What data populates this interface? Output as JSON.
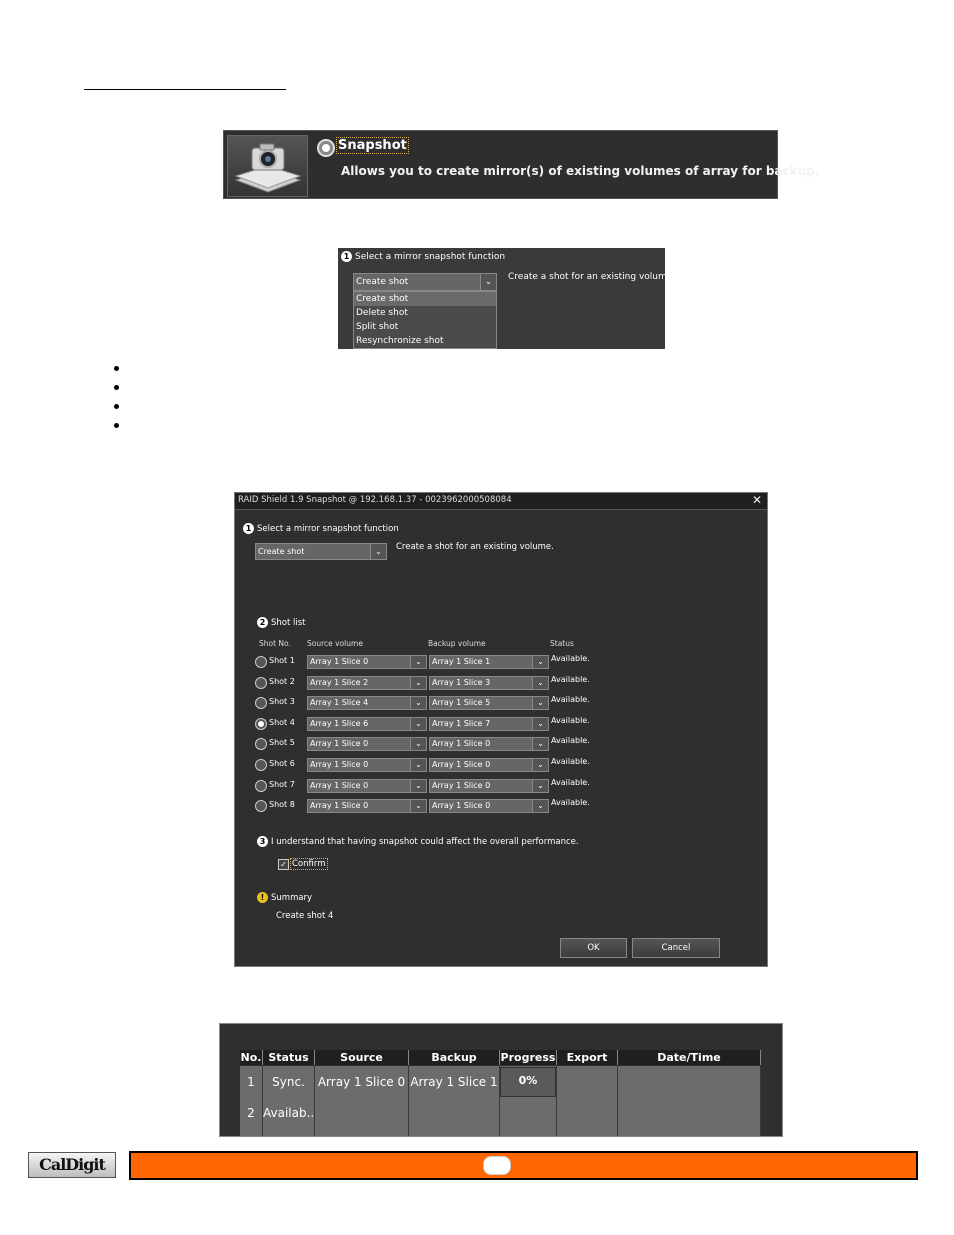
{
  "snapshot_banner": {
    "option_label": "Snapshot",
    "description": "Allows you to create mirror(s) of existing volumes of array for backup."
  },
  "function_panel": {
    "step_number": "1",
    "heading": "Select a mirror snapshot function",
    "selected": "Create shot",
    "description": "Create a shot for an existing volume.",
    "options": [
      "Create shot",
      "Delete shot",
      "Split shot",
      "Resynchronize shot"
    ]
  },
  "dialog": {
    "title": "RAID Shield 1.9 Snapshot @ 192.168.1.37 - 0023962000508084",
    "close_glyph": "✕",
    "step1": {
      "number": "1",
      "heading": "Select a mirror snapshot function",
      "selected": "Create shot",
      "description": "Create a shot for an existing volume."
    },
    "step2": {
      "number": "2",
      "heading": "Shot list"
    },
    "columns": {
      "shot_no": "Shot No.",
      "source": "Source volume",
      "backup": "Backup volume",
      "status": "Status"
    },
    "shots": [
      {
        "name": "Shot 1",
        "source": "Array 1 Slice 0",
        "backup": "Array 1 Slice 1",
        "status": "Available.",
        "selected": false
      },
      {
        "name": "Shot 2",
        "source": "Array 1 Slice 2",
        "backup": "Array 1 Slice 3",
        "status": "Available.",
        "selected": false
      },
      {
        "name": "Shot 3",
        "source": "Array 1 Slice 4",
        "backup": "Array 1 Slice 5",
        "status": "Available.",
        "selected": false
      },
      {
        "name": "Shot 4",
        "source": "Array 1 Slice 6",
        "backup": "Array 1 Slice 7",
        "status": "Available.",
        "selected": true
      },
      {
        "name": "Shot 5",
        "source": "Array 1 Slice 0",
        "backup": "Array 1 Slice 0",
        "status": "Available.",
        "selected": false
      },
      {
        "name": "Shot 6",
        "source": "Array 1 Slice 0",
        "backup": "Array 1 Slice 0",
        "status": "Available.",
        "selected": false
      },
      {
        "name": "Shot 7",
        "source": "Array 1 Slice 0",
        "backup": "Array 1 Slice 0",
        "status": "Available.",
        "selected": false
      },
      {
        "name": "Shot 8",
        "source": "Array 1 Slice 0",
        "backup": "Array 1 Slice 0",
        "status": "Available.",
        "selected": false
      }
    ],
    "step3": {
      "number": "3",
      "heading": "I understand that having snapshot could affect the overall performance.",
      "checkbox_label": "Confirm",
      "checked": true
    },
    "summary": {
      "icon": "!",
      "heading": "Summary",
      "text": "Create shot 4"
    },
    "ok_label": "OK",
    "cancel_label": "Cancel"
  },
  "status_table": {
    "headers": [
      "No.",
      "Status",
      "Source",
      "Backup",
      "Progress",
      "Export",
      "Date/Time"
    ],
    "rows": [
      {
        "no": "1",
        "status": "Sync.",
        "source": "Array 1 Slice 0",
        "backup": "Array 1 Slice 1",
        "progress": "0%"
      },
      {
        "no": "2",
        "status": "Availab..."
      }
    ]
  },
  "footer": {
    "logo_text": "CalDigit"
  }
}
